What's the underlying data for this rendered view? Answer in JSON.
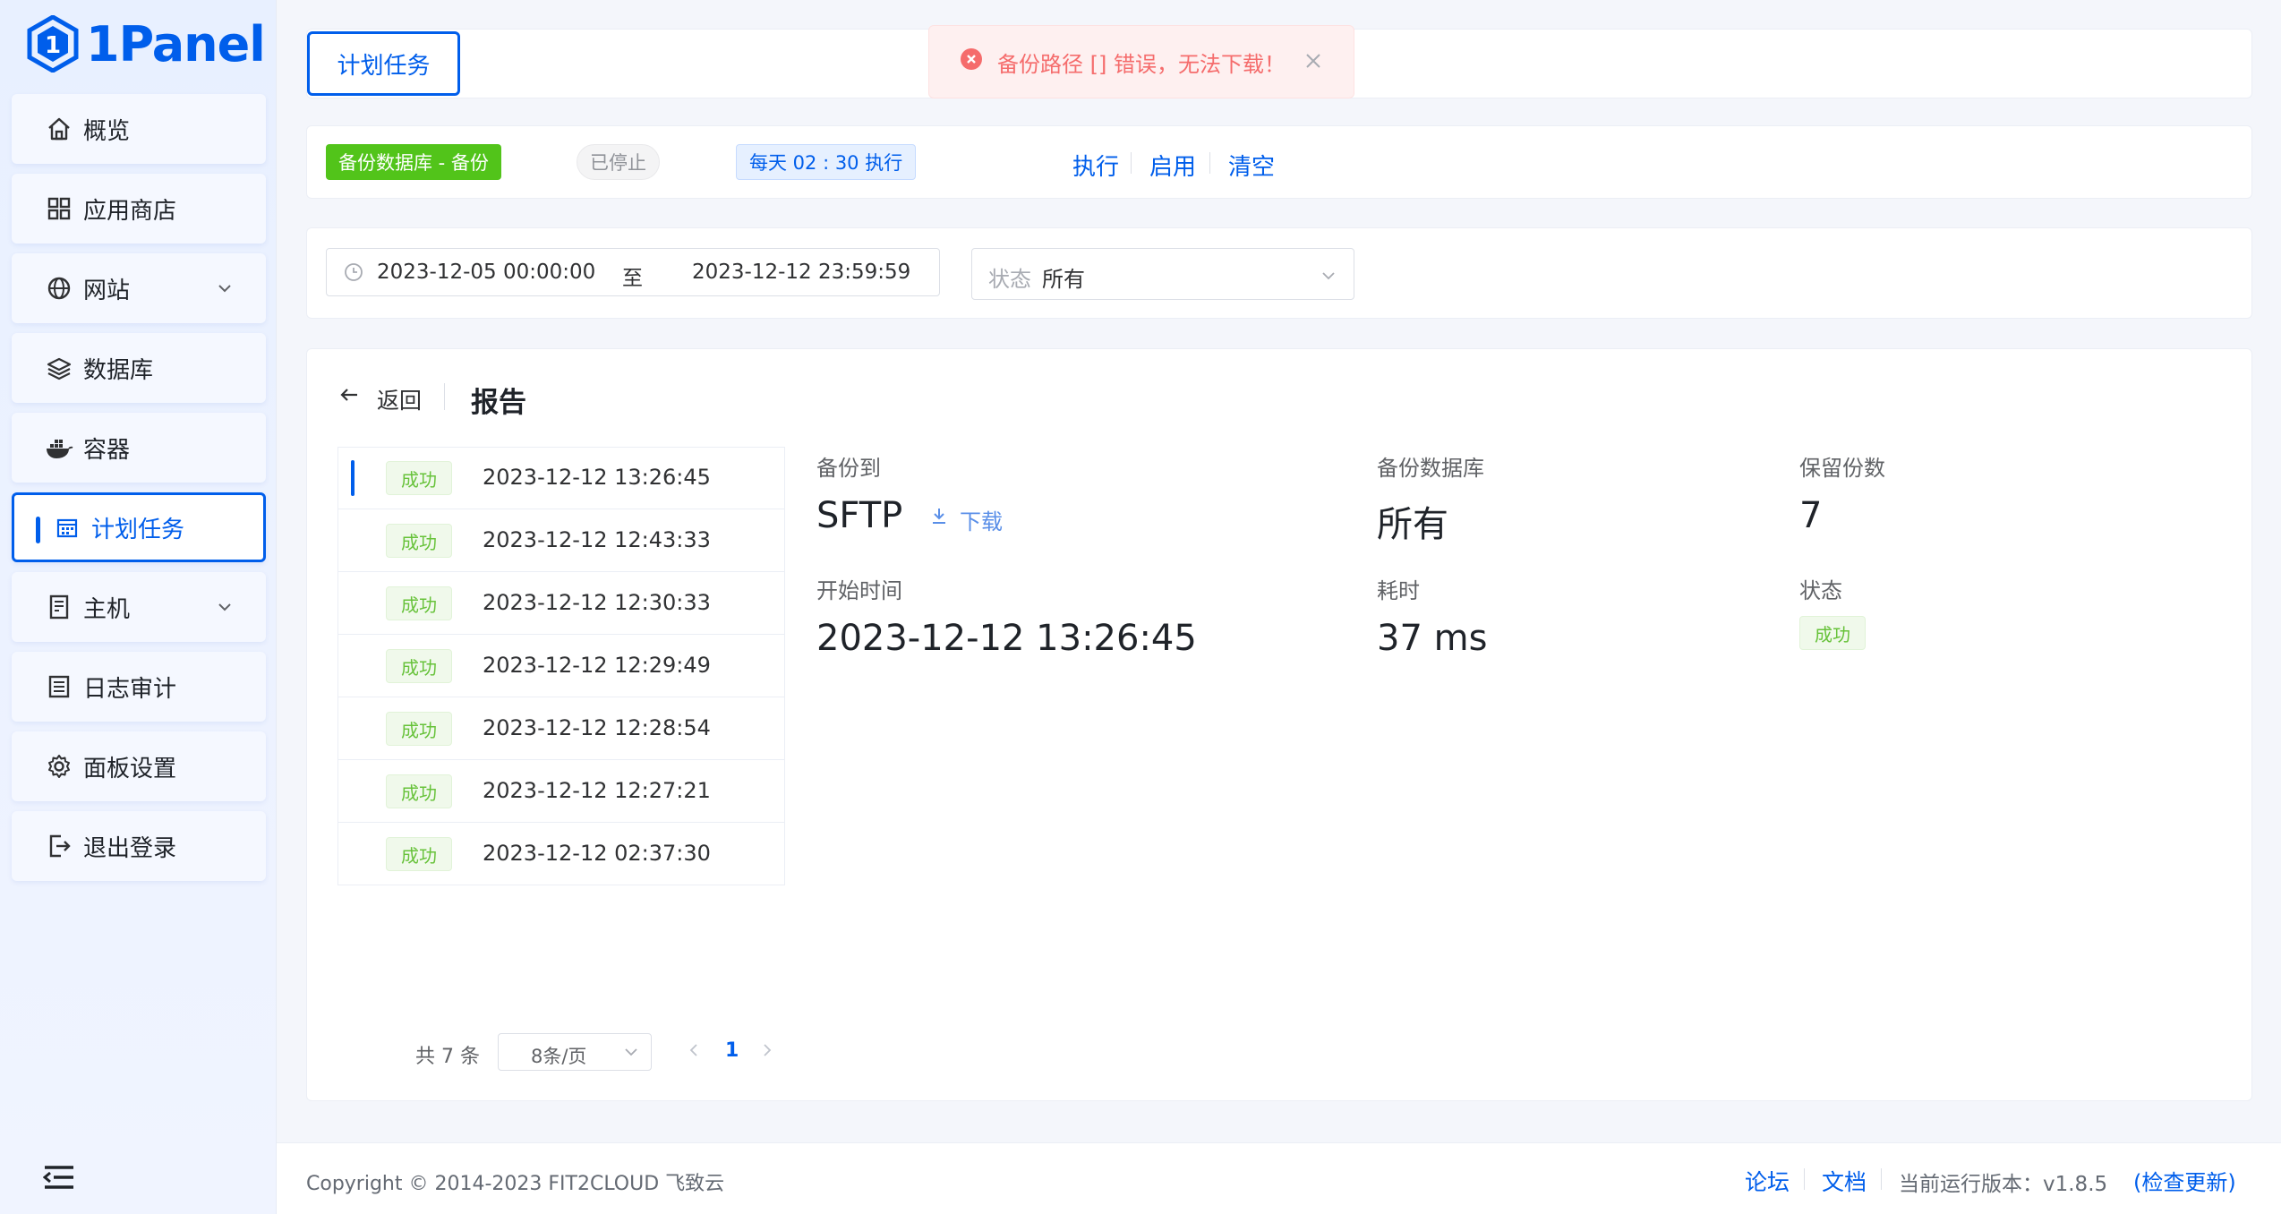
{
  "brand": {
    "name": "1Panel"
  },
  "sidebar": {
    "items": [
      {
        "label": "概览",
        "icon": "home-icon"
      },
      {
        "label": "应用商店",
        "icon": "grid-icon"
      },
      {
        "label": "网站",
        "icon": "globe-icon"
      },
      {
        "label": "数据库",
        "icon": "layers-icon"
      },
      {
        "label": "容器",
        "icon": "docker-icon"
      },
      {
        "label": "计划任务",
        "icon": "calendar-icon"
      },
      {
        "label": "主机",
        "icon": "server-icon"
      },
      {
        "label": "日志审计",
        "icon": "list-icon"
      },
      {
        "label": "面板设置",
        "icon": "gear-icon"
      },
      {
        "label": "退出登录",
        "icon": "logout-icon"
      }
    ]
  },
  "header": {
    "tab_label": "计划任务"
  },
  "toast": {
    "message": "备份路径 [] 错误，无法下载！"
  },
  "task": {
    "name_tag": "备份数据库 - 备份",
    "status_tag": "已停止",
    "schedule_tag": "每天 02 : 30 执行",
    "actions": {
      "execute": "执行",
      "enable": "启用",
      "clear": "清空"
    }
  },
  "filter": {
    "start": "2023-12-05 00:00:00",
    "to": "至",
    "end": "2023-12-12 23:59:59",
    "status_label": "状态",
    "status_value": "所有"
  },
  "report": {
    "back": "返回",
    "title": "报告",
    "records": [
      {
        "status": "成功",
        "time": "2023-12-12 13:26:45"
      },
      {
        "status": "成功",
        "time": "2023-12-12 12:43:33"
      },
      {
        "status": "成功",
        "time": "2023-12-12 12:30:33"
      },
      {
        "status": "成功",
        "time": "2023-12-12 12:29:49"
      },
      {
        "status": "成功",
        "time": "2023-12-12 12:28:54"
      },
      {
        "status": "成功",
        "time": "2023-12-12 12:27:21"
      },
      {
        "status": "成功",
        "time": "2023-12-12 02:37:30"
      }
    ],
    "detail": {
      "backup_to_label": "备份到",
      "backup_to_value": "SFTP",
      "download": "下载",
      "db_label": "备份数据库",
      "db_value": "所有",
      "retain_label": "保留份数",
      "retain_value": "7",
      "start_label": "开始时间",
      "start_value": "2023-12-12 13:26:45",
      "duration_label": "耗时",
      "duration_value": "37 ms",
      "status_label": "状态",
      "status_value": "成功"
    },
    "pagination": {
      "total": "共 7 条",
      "page_size": "8条/页",
      "current": "1"
    }
  },
  "footer": {
    "copyright": "Copyright © 2014-2023 FIT2CLOUD 飞致云",
    "forum": "论坛",
    "docs": "文档",
    "version": "当前运行版本：v1.8.5",
    "check_update": "(检查更新)"
  },
  "colors": {
    "primary": "#005eeb",
    "success": "#67c23a",
    "danger": "#f56c6c"
  }
}
